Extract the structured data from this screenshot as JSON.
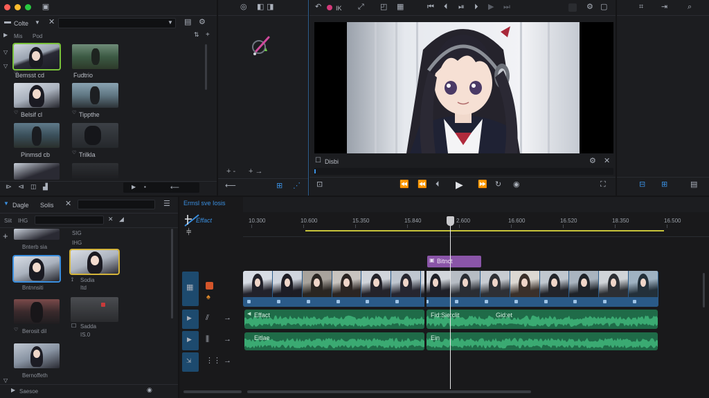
{
  "colors": {
    "accent": "#3a8fe0",
    "audio_green": "#1f6b48",
    "audio_wave": "#3fb57a",
    "title_clip": "#8a55a8",
    "selection_green": "#79c23a",
    "selection_yellow": "#d4b43a",
    "playhead": "#e8e8e8"
  },
  "browser": {
    "library_label": "Colte",
    "col_a": "Mis",
    "col_b": "Pod",
    "items": [
      {
        "label": "Bemsst cd"
      },
      {
        "label": "Fudtrio"
      },
      {
        "label": "Belsif cl"
      },
      {
        "label": "Tippthe"
      },
      {
        "label": "Pinmsd cb"
      },
      {
        "label": "Trilkla"
      }
    ]
  },
  "inspector_tools": {
    "btn_a": "+ -",
    "btn_b": "+ →"
  },
  "viewer": {
    "toolbar_label": "IK",
    "clip_label": "Disbi"
  },
  "library2": {
    "tab_a": "Dagle",
    "tab_b": "Solis",
    "filter_label": "Siit",
    "filter_value": "IHG",
    "items": [
      {
        "label": "Bnterb sia",
        "sub": ""
      },
      {
        "label": "Bntnnsiti",
        "sub": ""
      },
      {
        "label": "Sodia",
        "sub": "Itd"
      },
      {
        "label": "Berosit dil",
        "sub": ""
      },
      {
        "label": "Sadda",
        "sub": "IS.0"
      },
      {
        "label": "Bernoffeth",
        "sub": ""
      }
    ],
    "extra_top": [
      "SIG",
      "IHG"
    ],
    "footer_label": "Saesoe"
  },
  "timeline": {
    "header_label": "Ermsl sve Iosis",
    "effect_label": "Effact",
    "ruler": [
      "10.300",
      "10.600",
      "15.350",
      "15.840",
      "2.600",
      "16.600",
      "16.520",
      "18.350",
      "16.500"
    ],
    "title_clip": "Bitnct",
    "audio1_left": "Effact",
    "audio1_mid": "Fid:Sie:clit",
    "audio1_right": "Gid:et",
    "audio2_left": "Eitlae",
    "audio2_mid": "Ein"
  }
}
